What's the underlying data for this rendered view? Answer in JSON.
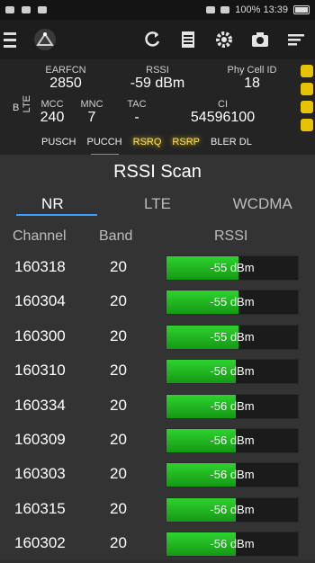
{
  "status_bar": {
    "right_text": "100% 13:39"
  },
  "info": {
    "earfcn_label": "EARFCN",
    "earfcn": "2850",
    "rssi_label": "RSSI",
    "rssi": "-59 dBm",
    "phycell_label": "Phy Cell ID",
    "phycell": "18",
    "mcc_label": "MCC",
    "mcc": "240",
    "mnc_label": "MNC",
    "mnc": "7",
    "tac_label": "TAC",
    "tac": "-",
    "ci_label": "CI",
    "ci": "54596100",
    "tech_side": "LTE",
    "b_label": "B",
    "metric_tabs": [
      "PUSCH",
      "PUCCH",
      "RSRQ",
      "RSRP",
      "BLER DL"
    ]
  },
  "dialog": {
    "title": "RSSI Scan",
    "tabs": [
      "NR",
      "LTE",
      "WCDMA"
    ],
    "active_tab": "NR",
    "columns": [
      "Channel",
      "Band",
      "RSSI"
    ],
    "rows": [
      {
        "channel": "160318",
        "band": "20",
        "rssi": "-55 dBm",
        "level": 0.55
      },
      {
        "channel": "160304",
        "band": "20",
        "rssi": "-55 dBm",
        "level": 0.55
      },
      {
        "channel": "160300",
        "band": "20",
        "rssi": "-55 dBm",
        "level": 0.55
      },
      {
        "channel": "160310",
        "band": "20",
        "rssi": "-56 dBm",
        "level": 0.53
      },
      {
        "channel": "160334",
        "band": "20",
        "rssi": "-56 dBm",
        "level": 0.53
      },
      {
        "channel": "160309",
        "band": "20",
        "rssi": "-56 dBm",
        "level": 0.53
      },
      {
        "channel": "160303",
        "band": "20",
        "rssi": "-56 dBm",
        "level": 0.53
      },
      {
        "channel": "160315",
        "band": "20",
        "rssi": "-56 dBm",
        "level": 0.53
      },
      {
        "channel": "160302",
        "band": "20",
        "rssi": "-56 dBm",
        "level": 0.53
      }
    ]
  },
  "icons": [
    "menu-icon",
    "app-logo-icon",
    "refresh-icon",
    "list-icon",
    "settings-icon",
    "camera-icon",
    "sort-icon"
  ],
  "colors": {
    "bar_fill": "#22b322",
    "accent": "#3aa0ff",
    "highlight": "#ffd200"
  }
}
